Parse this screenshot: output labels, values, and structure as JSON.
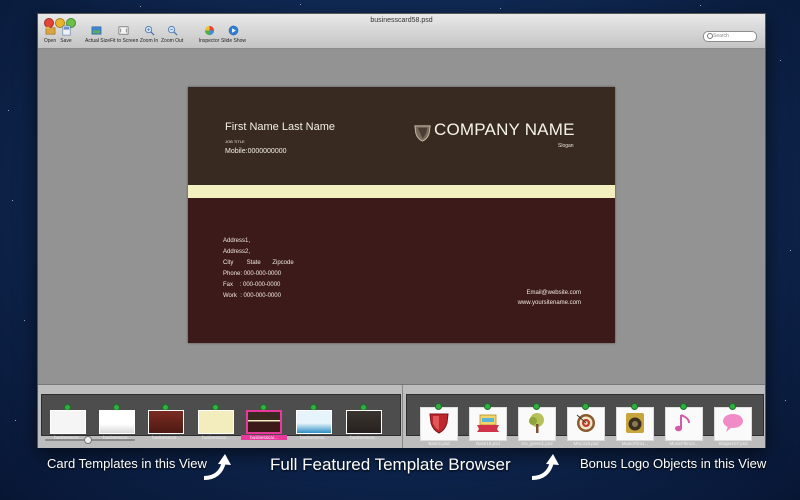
{
  "window": {
    "title": "businesscard58.psd"
  },
  "toolbar": {
    "items": [
      {
        "label": "Open",
        "icon": "open-folder-icon"
      },
      {
        "label": "Save",
        "icon": "save-icon"
      },
      {
        "label": "Actual Size",
        "icon": "actual-size-icon"
      },
      {
        "label": "Fit to Screen",
        "icon": "fit-to-screen-icon"
      },
      {
        "label": "Zoom In",
        "icon": "zoom-in-icon"
      },
      {
        "label": "Zoom Out",
        "icon": "zoom-out-icon"
      },
      {
        "label": "Inspector",
        "icon": "inspector-icon"
      },
      {
        "label": "Slide Show",
        "icon": "slide-show-icon"
      }
    ],
    "search_placeholder": "Search"
  },
  "card": {
    "name": "First Name Last Name",
    "job_title": "JOB TITLE",
    "mobile": "Mobile:0000000000",
    "company": "COMPANY NAME",
    "slogan": "Slogan",
    "address1": "Address1,",
    "address2": "Address2,",
    "city_line": "City        State       Zipcode",
    "phone": "Phone: 000-000-0000",
    "fax": "Fax    : 000-000-0000",
    "work": "Work  : 000-000-0000",
    "email": "Email@website.com",
    "website": "www.yoursitename.com",
    "colors": {
      "top": "#382a20",
      "stripe": "#f3efbf",
      "bottom": "#3d1a1a"
    }
  },
  "templates": [
    {
      "label": "businesscar..."
    },
    {
      "label": "businesscar..."
    },
    {
      "label": "businesscar..."
    },
    {
      "label": "businesscar..."
    },
    {
      "label": "businesscar...",
      "selected": true
    },
    {
      "label": "businesscar..."
    },
    {
      "label": "businesscar..."
    }
  ],
  "logos": [
    {
      "label": "Base1.psd",
      "icon": "red-shield-icon"
    },
    {
      "label": "Base18.psd",
      "icon": "ribbon-banner-icon"
    },
    {
      "label": "Go_green1.psd",
      "icon": "tree-icon"
    },
    {
      "label": "Misc119.psd",
      "icon": "target-arrow-icon"
    },
    {
      "label": "MusicFilm1...",
      "icon": "speaker-icon"
    },
    {
      "label": "MusicFilm14...",
      "icon": "music-note-icon"
    },
    {
      "label": "Shape107.psd",
      "icon": "speech-bubble-icon"
    }
  ],
  "captions": {
    "left": "Card Templates in this View",
    "center": "Full Featured Template Browser",
    "right": "Bonus Logo Objects in this View"
  }
}
